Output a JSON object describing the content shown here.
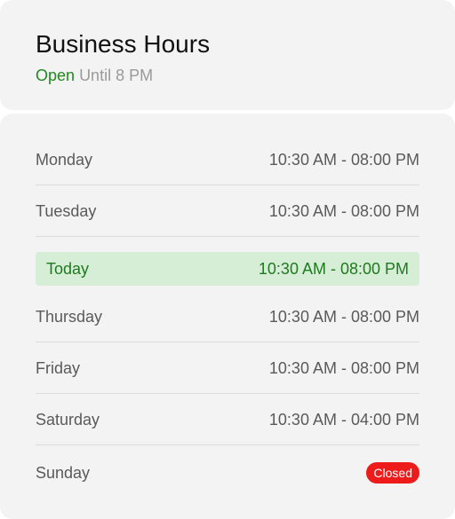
{
  "header": {
    "title": "Business Hours",
    "status_open": "Open",
    "status_until": "Until 8 PM"
  },
  "hours": [
    {
      "day": "Monday",
      "time": "10:30 AM - 08:00 PM"
    },
    {
      "day": "Tuesday",
      "time": "10:30 AM - 08:00 PM"
    },
    {
      "day": "Today",
      "time": "10:30 AM - 08:00 PM"
    },
    {
      "day": "Thursday",
      "time": "10:30 AM - 08:00 PM"
    },
    {
      "day": "Friday",
      "time": "10:30 AM - 08:00 PM"
    },
    {
      "day": "Saturday",
      "time": "10:30 AM - 04:00 PM"
    },
    {
      "day": "Sunday",
      "badge": "Closed"
    }
  ],
  "colors": {
    "open_green": "#1f8a1f",
    "today_highlight": "#d6edd6",
    "closed_red": "#ee1b1b"
  }
}
